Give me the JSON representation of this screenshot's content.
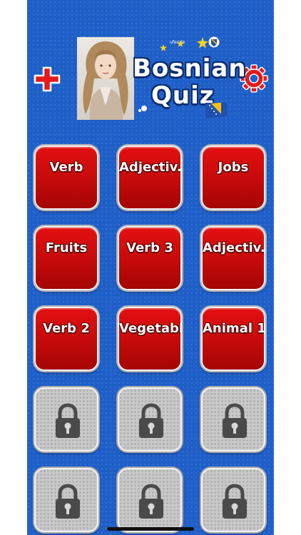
{
  "header": {
    "title_line1": "Bosnian",
    "title_line2": "Quiz",
    "small_text": "ufen te"
  },
  "buttons": {
    "add": "plus-icon",
    "settings": "gear-icon"
  },
  "categories": [
    {
      "label": "Verb",
      "locked": false
    },
    {
      "label": "Adjectiv...",
      "locked": false
    },
    {
      "label": "Jobs",
      "locked": false
    },
    {
      "label": "Fruits",
      "locked": false
    },
    {
      "label": "Verb 3",
      "locked": false
    },
    {
      "label": "Adjectiv...",
      "locked": false
    },
    {
      "label": "Verb 2",
      "locked": false
    },
    {
      "label": "Vegetabl...",
      "locked": false
    },
    {
      "label": "Animal 1",
      "locked": false
    }
  ],
  "locked_tiles": 6,
  "colors": {
    "background": "#1f5fc8",
    "tile_red": "#d40c0c",
    "tile_locked": "#c9c9c9"
  }
}
